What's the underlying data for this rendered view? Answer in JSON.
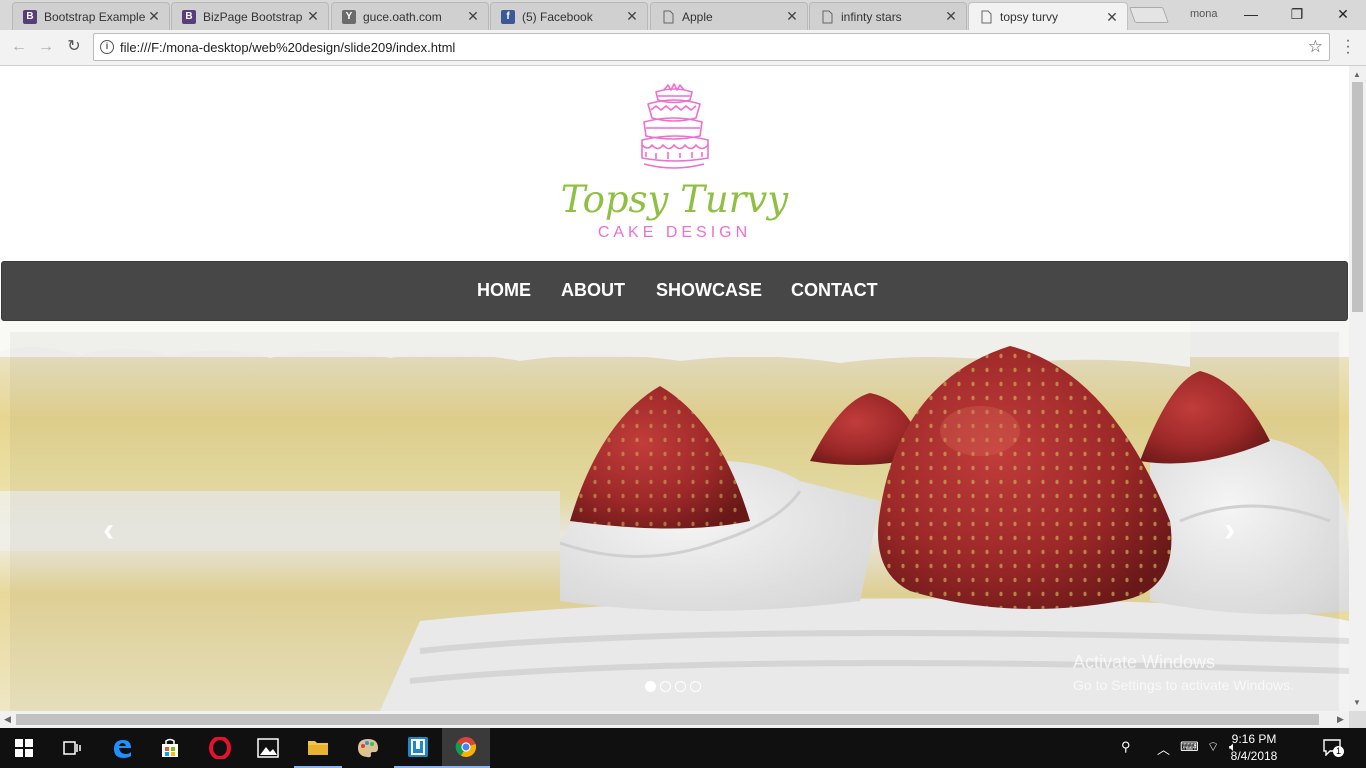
{
  "browser": {
    "tabs": [
      {
        "label": "Bootstrap Example",
        "favicon": "B"
      },
      {
        "label": "BizPage Bootstrap",
        "favicon": "B"
      },
      {
        "label": "guce.oath.com",
        "favicon": "Y"
      },
      {
        "label": "(5) Facebook",
        "favicon": "f"
      },
      {
        "label": "Apple",
        "favicon": ""
      },
      {
        "label": "infinty stars",
        "favicon": ""
      },
      {
        "label": "topsy turvy",
        "favicon": ""
      }
    ],
    "profile_name": "mona",
    "url": "file:///F:/mona-desktop/web%20design/slide209/index.html"
  },
  "site": {
    "brand_title": "Topsy Turvy",
    "brand_subtitle": "CAKE DESIGN",
    "nav": [
      "HOME",
      "ABOUT",
      "SHOWCASE",
      "CONTACT"
    ],
    "carousel": {
      "slide_count": 4,
      "active_slide": 1,
      "prev_glyph": "‹",
      "next_glyph": "›"
    }
  },
  "watermark": {
    "line1": "Activate Windows",
    "line2": "Go to Settings to activate Windows."
  },
  "taskbar": {
    "time": "9:16 PM",
    "date": "8/4/2018",
    "notification_count": "1"
  },
  "colors": {
    "brand_green": "#8fc043",
    "brand_pink": "#ee6fd0",
    "navbar_bg": "#474747"
  }
}
